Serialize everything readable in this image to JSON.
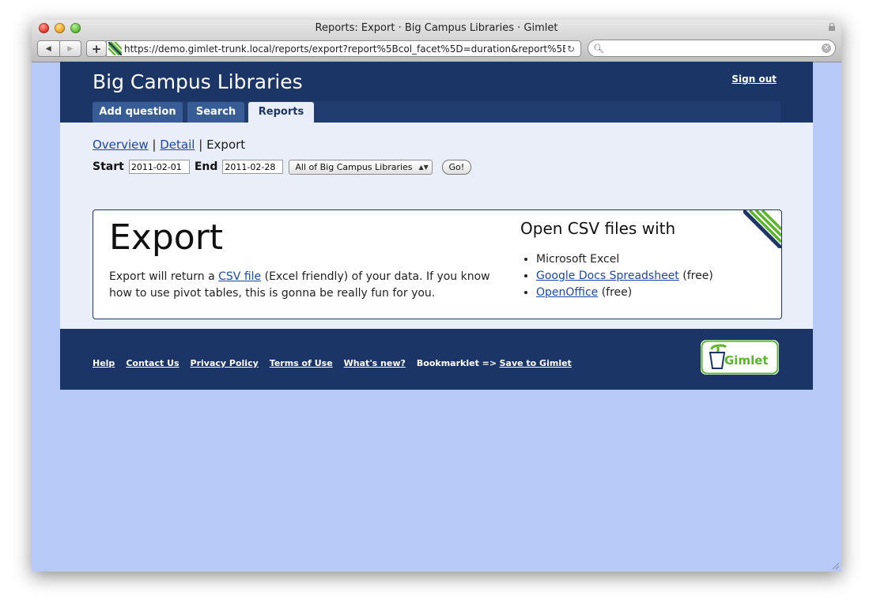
{
  "browser": {
    "title": "Reports: Export · Big Campus Libraries · Gimlet",
    "url": "https://demo.gimlet-trunk.local/reports/export?report%5Bcol_facet%5D=duration&report%5B",
    "search_value": ""
  },
  "site": {
    "title": "Big Campus Libraries",
    "signout": "Sign out"
  },
  "tabs": [
    {
      "label": "Add question"
    },
    {
      "label": "Search"
    },
    {
      "label": "Reports"
    }
  ],
  "breadcrumb": {
    "overview": "Overview",
    "sep1": "|",
    "detail": "Detail",
    "sep2": "|",
    "current": "Export"
  },
  "filters": {
    "start_label": "Start",
    "start_value": "2011-02-01",
    "end_label": "End",
    "end_value": "2011-02-28",
    "location_selected": "All of Big Campus Libraries",
    "go_label": "Go!"
  },
  "export_card": {
    "title": "Export",
    "desc_before": "Export will return a ",
    "desc_link": "CSV file",
    "desc_after": " (Excel friendly) of your data. If you know how to use pivot tables, this is gonna be really fun for you.",
    "side_title": "Open CSV files with",
    "apps": [
      {
        "name": "Microsoft Excel",
        "suffix": ""
      },
      {
        "name": "Google Docs Spreadsheet",
        "suffix": " (free)"
      },
      {
        "name": "OpenOffice",
        "suffix": " (free)"
      }
    ]
  },
  "footer": {
    "help": "Help",
    "contact": "Contact Us",
    "privacy": "Privacy Policy",
    "terms": "Terms of Use",
    "whats_new": "What's new?",
    "bookmarklet_label": "Bookmarklet =>",
    "bookmarklet_link": "Save to Gimlet",
    "logo_text": "Gimlet"
  },
  "colors": {
    "navy": "#1b3566",
    "tab": "#385d96",
    "page_bg": "#eaeef9",
    "window_bg": "#b8cbf8",
    "link": "#1a47a8",
    "logo_green": "#5ab52a"
  }
}
